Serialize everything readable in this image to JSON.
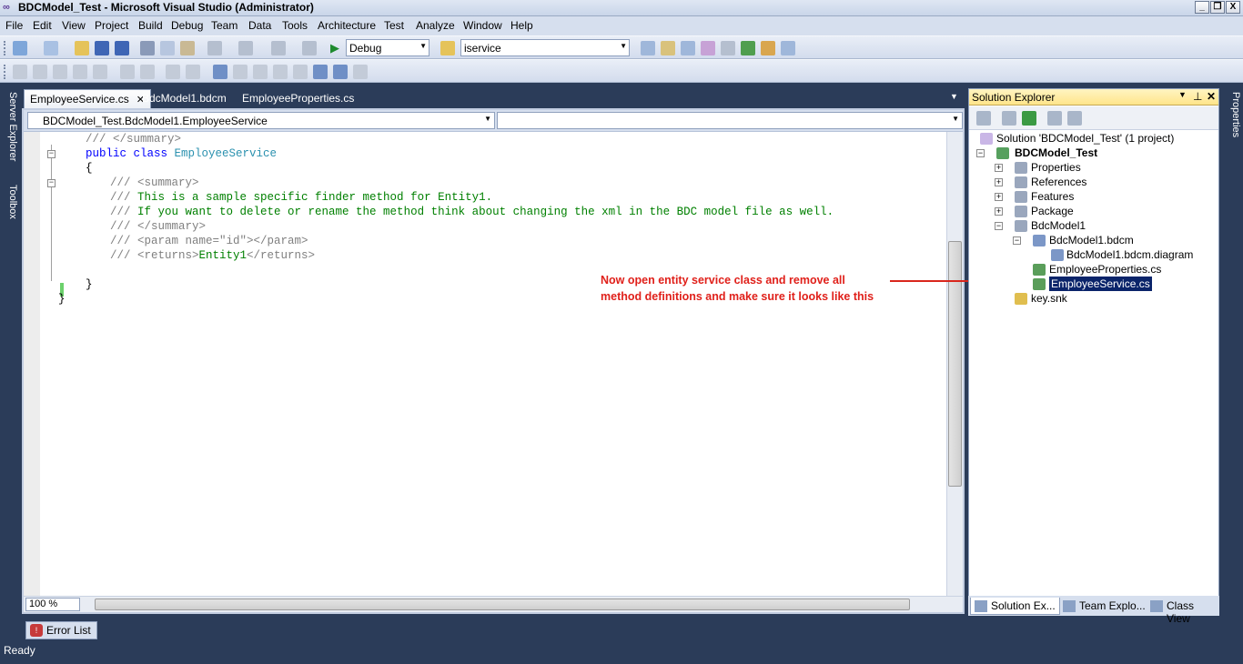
{
  "window": {
    "title": "BDCModel_Test - Microsoft Visual Studio (Administrator)",
    "minimize": "_",
    "restore": "❐",
    "close": "X"
  },
  "menu": [
    "File",
    "Edit",
    "View",
    "Project",
    "Build",
    "Debug",
    "Team",
    "Data",
    "Tools",
    "Architecture",
    "Test",
    "Analyze",
    "Window",
    "Help"
  ],
  "toolbar": {
    "config": "Debug",
    "find": "iservice"
  },
  "left_strip": {
    "server_explorer": "Server Explorer",
    "toolbox": "Toolbox"
  },
  "right_strip": {
    "properties": "Properties"
  },
  "editor": {
    "tabs": [
      "EmployeeService.cs",
      "BdcModel1.bdcm",
      "EmployeeProperties.cs"
    ],
    "close_glyph": "✕",
    "dropdown_glyph": "▼",
    "nav_type": "BDCModel_Test.BdcModel1.EmployeeService",
    "nav_member": "",
    "zoom": "100 %",
    "code": {
      "l1": "/// </summary>",
      "l2_kw": "public class ",
      "l2_type": "EmployeeService",
      "l3": "{",
      "l4": "/// <summary>",
      "l5_prefix": "/// ",
      "l5": "This is a sample specific finder method for Entity1.",
      "l6_prefix": "/// ",
      "l6": "If you want to delete or rename the method think about changing the xml in the BDC model file as well.",
      "l7": "/// </summary>",
      "l8": "/// <param name=\"id\"></param>",
      "l9_a": "/// <returns>",
      "l9_b": "Entity1",
      "l9_c": "</returns>",
      "l10": "}",
      "l11": "}"
    }
  },
  "annotation": {
    "line1": "Now open entity service class and remove all",
    "line2": "method definitions and make sure it looks like this"
  },
  "solution_explorer": {
    "title": "Solution Explorer",
    "solution": "Solution 'BDCModel_Test' (1 project)",
    "project": "BDCModel_Test",
    "items": {
      "properties": "Properties",
      "references": "References",
      "features": "Features",
      "package": "Package",
      "bdcmodel": "BdcModel1",
      "bdcm": "BdcModel1.bdcm",
      "diagram": "BdcModel1.bdcm.diagram",
      "employee_properties": "EmployeeProperties.cs",
      "employee_service": "EmployeeService.cs",
      "key": "key.snk"
    },
    "tabs": [
      "Solution Ex...",
      "Team Explo...",
      "Class View"
    ]
  },
  "error_list": "Error List",
  "status": "Ready"
}
